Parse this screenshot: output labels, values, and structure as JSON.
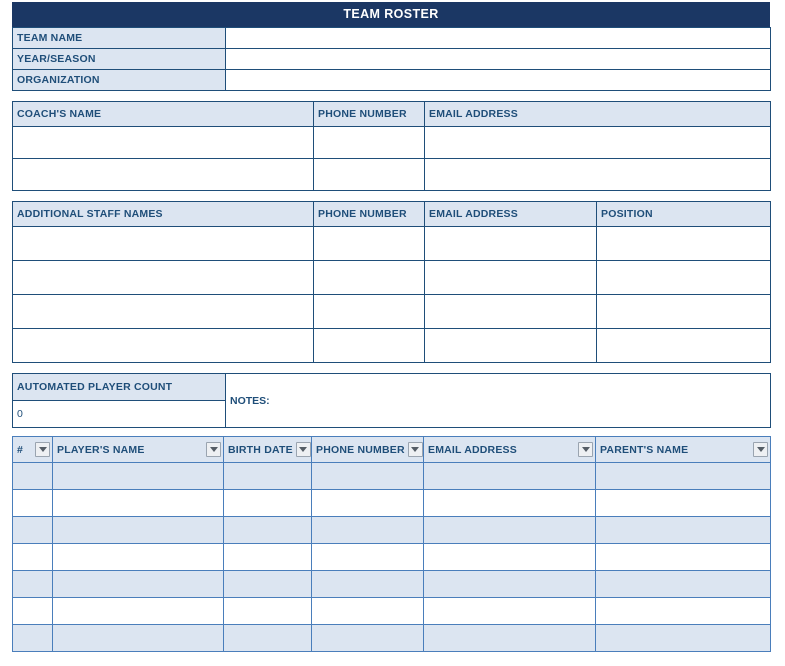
{
  "document": {
    "title": "TEAM ROSTER"
  },
  "info": {
    "rows": [
      {
        "label": "TEAM NAME",
        "value": ""
      },
      {
        "label": "YEAR/SEASON",
        "value": ""
      },
      {
        "label": "ORGANIZATION",
        "value": ""
      }
    ]
  },
  "coach": {
    "headers": [
      "COACH'S NAME",
      "PHONE NUMBER",
      "EMAIL ADDRESS"
    ],
    "rows": [
      [
        "",
        "",
        ""
      ],
      [
        "",
        "",
        ""
      ]
    ]
  },
  "staff": {
    "headers": [
      "ADDITIONAL STAFF NAMES",
      "PHONE NUMBER",
      "EMAIL ADDRESS",
      "POSITION"
    ],
    "rows": [
      [
        "",
        "",
        "",
        ""
      ],
      [
        "",
        "",
        "",
        ""
      ],
      [
        "",
        "",
        "",
        ""
      ],
      [
        "",
        "",
        "",
        ""
      ]
    ]
  },
  "summary": {
    "count_label": "AUTOMATED PLAYER COUNT",
    "count_value": "0",
    "notes_label": "NOTES:",
    "notes_value": ""
  },
  "roster": {
    "headers": [
      {
        "label": "#",
        "filter": "filter-dropdown-icon"
      },
      {
        "label": "PLAYER'S NAME",
        "filter": "filter-dropdown-icon"
      },
      {
        "label": "BIRTH DATE",
        "filter": "filter-dropdown-icon"
      },
      {
        "label": "PHONE NUMBER",
        "filter": "filter-dropdown-icon"
      },
      {
        "label": "EMAIL ADDRESS",
        "filter": "filter-dropdown-icon"
      },
      {
        "label": "PARENT'S NAME",
        "filter": "filter-dropdown-icon"
      }
    ],
    "rows": [
      [
        "",
        "",
        "",
        "",
        "",
        ""
      ],
      [
        "",
        "",
        "",
        "",
        "",
        ""
      ],
      [
        "",
        "",
        "",
        "",
        "",
        ""
      ],
      [
        "",
        "",
        "",
        "",
        "",
        ""
      ],
      [
        "",
        "",
        "",
        "",
        "",
        ""
      ],
      [
        "",
        "",
        "",
        "",
        "",
        ""
      ],
      [
        "",
        "",
        "",
        "",
        "",
        ""
      ]
    ]
  },
  "colors": {
    "title_bar": "#1b3764",
    "header_fill": "#dce5f1",
    "text_blue": "#1f4e79",
    "grid_line": "#1f4e79",
    "roster_grid_line": "#4a7ebb"
  }
}
